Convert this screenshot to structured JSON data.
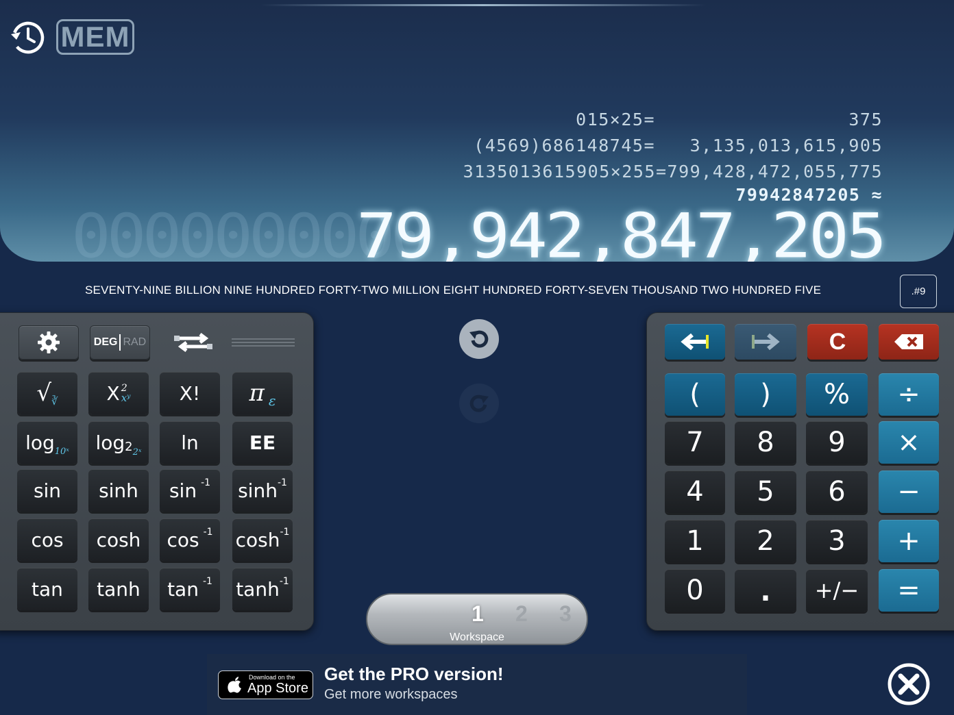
{
  "header": {
    "mem_label": "MEM"
  },
  "tape": [
    {
      "expr": "015×25=",
      "result": "375"
    },
    {
      "expr": "(4569)686148745=",
      "result": "3,135,013,615,905"
    },
    {
      "expr": "3135013615905×255=",
      "result": "799,428,472,055,775"
    }
  ],
  "current_entry": {
    "expr": "79942847205",
    "symbol": "≈"
  },
  "display": {
    "value": "79,942,847,205",
    "ghost": "0000000000",
    "words": "SEVENTY-NINE BILLION NINE HUNDRED FORTY-TWO MILLION EIGHT HUNDRED FORTY-SEVEN THOUSAND TWO HUNDRED FIVE",
    "format_label": ".#9"
  },
  "sci_panel": {
    "top": {
      "deg": "DEG",
      "rad": "RAD"
    },
    "keys": {
      "sqrt": "√",
      "x2": "X",
      "x2_sup": "2",
      "x2_sub": "xʸ",
      "fact": "X!",
      "pi": "π",
      "pi_sub": "ε",
      "log": "log",
      "log_sub": "10ˣ",
      "log2": "log",
      "log2_sub": "2",
      "log2_sub2": "2ˣ",
      "ln": "ln",
      "ee": "EE",
      "sin": "sin",
      "sinh": "sinh",
      "asin": "sin",
      "asinh": "sinh",
      "cos": "cos",
      "cosh": "cosh",
      "acos": "cos",
      "acosh": "cosh",
      "tan": "tan",
      "tanh": "tanh",
      "atan": "tan",
      "atanh": "tanh",
      "inv_sup": "-1"
    }
  },
  "num_panel": {
    "clear": "C",
    "keys": {
      "lparen": "(",
      "rparen": ")",
      "percent": "%",
      "divide": "÷",
      "k7": "7",
      "k8": "8",
      "k9": "9",
      "multiply": "×",
      "k4": "4",
      "k5": "5",
      "k6": "6",
      "minus": "−",
      "k1": "1",
      "k2": "2",
      "k3": "3",
      "plus": "+",
      "k0": "0",
      "dot": ".",
      "negate": "+/−",
      "equals": "="
    }
  },
  "workspace": {
    "tabs": [
      "1",
      "2",
      "3"
    ],
    "active": "1",
    "label": "Workspace"
  },
  "ad": {
    "badge_small": "Download on the",
    "badge_big": "App Store",
    "title": "Get the PRO version!",
    "subtitle": "Get more workspaces"
  },
  "colors": {
    "background": "#16294a",
    "blue_key": "#1b6a93",
    "red_key": "#b63322",
    "dark_key": "#1d2024"
  }
}
